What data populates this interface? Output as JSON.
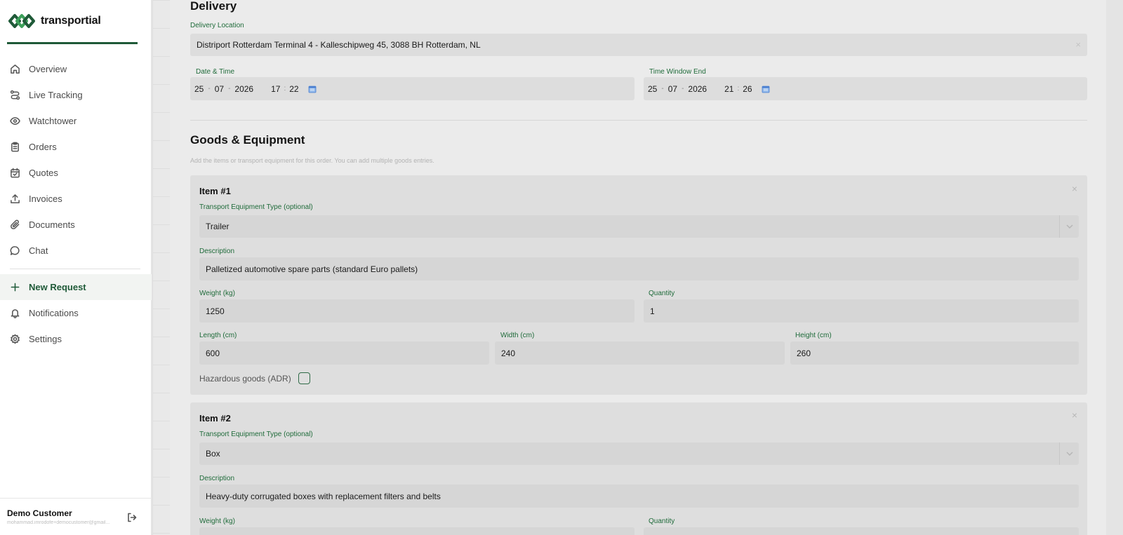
{
  "brand": {
    "name": "transportial",
    "color_primary": "#1f5a38",
    "color_accent": "#3da05a"
  },
  "sidebar": {
    "items": [
      {
        "label": "Overview",
        "icon": "home-icon"
      },
      {
        "label": "Live Tracking",
        "icon": "route-icon"
      },
      {
        "label": "Watchtower",
        "icon": "eye-icon"
      },
      {
        "label": "Orders",
        "icon": "clipboard-icon"
      },
      {
        "label": "Quotes",
        "icon": "calendar-check-icon"
      },
      {
        "label": "Invoices",
        "icon": "upload-icon"
      },
      {
        "label": "Documents",
        "icon": "paperclip-icon"
      },
      {
        "label": "Chat",
        "icon": "chat-bubble-icon"
      }
    ],
    "items_secondary": [
      {
        "label": "New Request",
        "icon": "plus-icon",
        "active": true
      },
      {
        "label": "Notifications",
        "icon": "bell-icon"
      },
      {
        "label": "Settings",
        "icon": "gear-icon"
      }
    ],
    "user": {
      "name": "Demo Customer",
      "email": "mohammad.imrodofe+democustomer@gmail..."
    }
  },
  "delivery": {
    "heading": "Delivery",
    "location_label": "Delivery Location",
    "location_value": "Distriport Rotterdam Terminal 4 - Kalleschipweg 45, 3088 BH Rotterdam, NL",
    "datetime_label": "Date & Time",
    "datetime": {
      "day": "25",
      "month": "07",
      "year": "2026",
      "hour": "17",
      "minute": "22"
    },
    "window_end_label": "Time Window End",
    "window_end": {
      "day": "25",
      "month": "07",
      "year": "2026",
      "hour": "21",
      "minute": "26"
    }
  },
  "goods": {
    "heading": "Goods & Equipment",
    "help": "Add the items or transport equipment for this order. You can add multiple goods entries.",
    "items": [
      {
        "title": "Item #1",
        "equipment_label": "Transport Equipment Type (optional)",
        "equipment_value": "Trailer",
        "description_label": "Description",
        "description_value": "Palletized automotive spare parts (standard Euro pallets)",
        "weight_label": "Weight (kg)",
        "weight_value": "1250",
        "quantity_label": "Quantity",
        "quantity_value": "1",
        "length_label": "Length (cm)",
        "length_value": "600",
        "width_label": "Width (cm)",
        "width_value": "240",
        "height_label": "Height (cm)",
        "height_value": "260",
        "hazardous_label": "Hazardous goods (ADR)"
      },
      {
        "title": "Item #2",
        "equipment_label": "Transport Equipment Type (optional)",
        "equipment_value": "Box",
        "description_label": "Description",
        "description_value": "Heavy-duty corrugated boxes with replacement filters and belts",
        "weight_label": "Weight (kg)",
        "quantity_label": "Quantity"
      }
    ]
  }
}
